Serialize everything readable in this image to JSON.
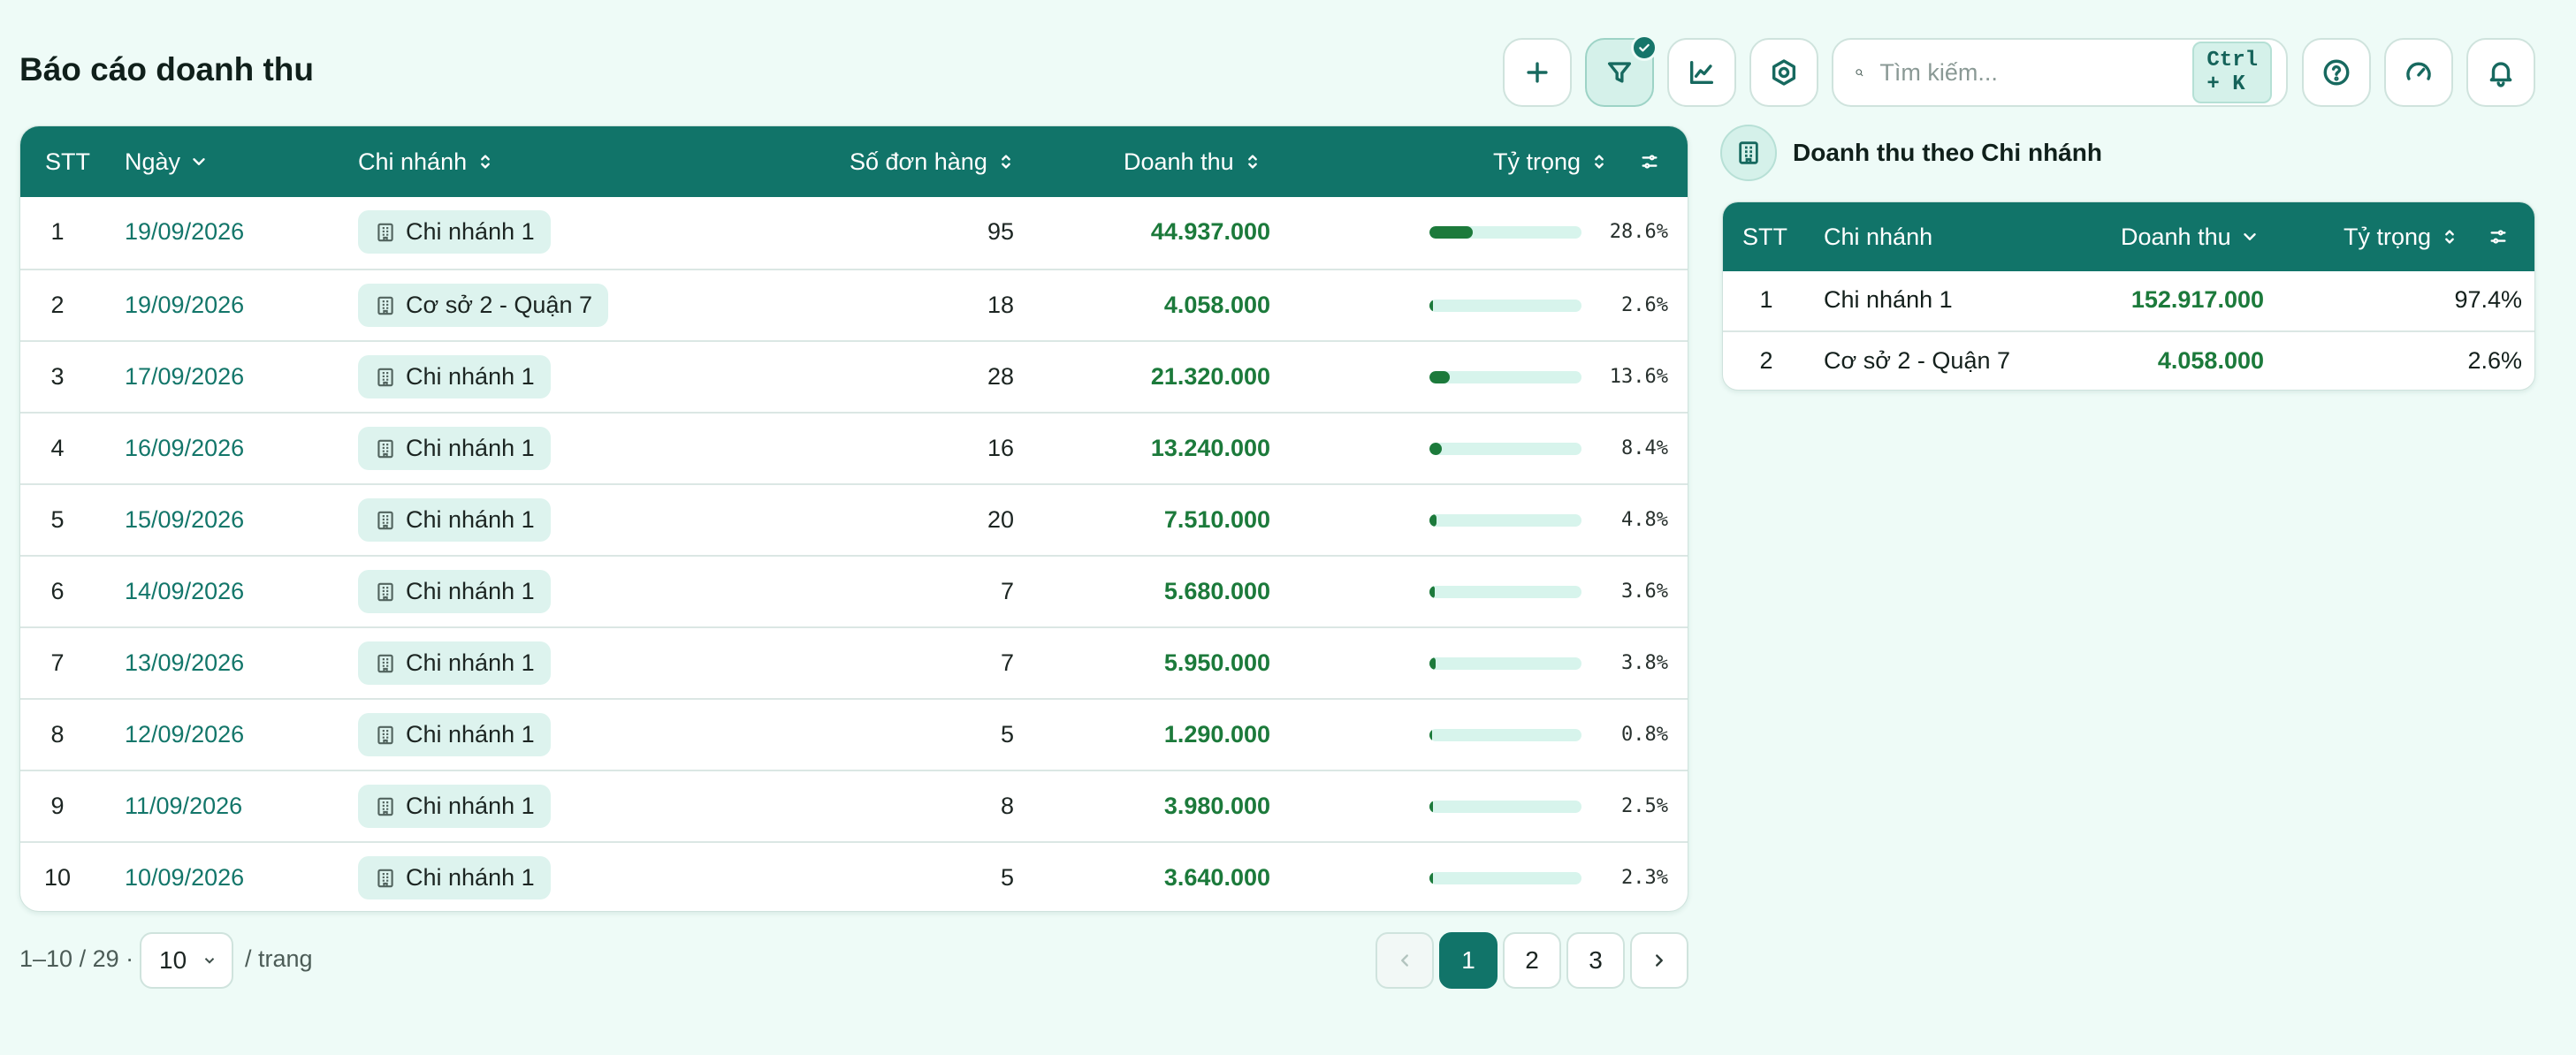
{
  "page": {
    "title": "Báo cáo doanh thu"
  },
  "search": {
    "placeholder": "Tìm kiếm...",
    "shortcut": "Ctrl + K"
  },
  "toolbar": {
    "icons": [
      "plus-icon",
      "filter-icon",
      "line-chart-icon",
      "settings-icon",
      "search-icon",
      "help-icon",
      "gauge-icon",
      "bell-icon"
    ],
    "filter_active": true
  },
  "table": {
    "columns": {
      "stt": "STT",
      "date": "Ngày",
      "branch": "Chi nhánh",
      "orders": "Số đơn hàng",
      "revenue": "Doanh thu",
      "share": "Tỷ trọng"
    },
    "rows": [
      {
        "stt": "1",
        "date": "19/09/2026",
        "branch": "Chi nhánh 1",
        "orders": "95",
        "revenue": "44.937.000",
        "share": "28.6%",
        "share_value": 28.6
      },
      {
        "stt": "2",
        "date": "19/09/2026",
        "branch": "Cơ sở 2 - Quận 7",
        "orders": "18",
        "revenue": "4.058.000",
        "share": "2.6%",
        "share_value": 2.6
      },
      {
        "stt": "3",
        "date": "17/09/2026",
        "branch": "Chi nhánh 1",
        "orders": "28",
        "revenue": "21.320.000",
        "share": "13.6%",
        "share_value": 13.6
      },
      {
        "stt": "4",
        "date": "16/09/2026",
        "branch": "Chi nhánh 1",
        "orders": "16",
        "revenue": "13.240.000",
        "share": "8.4%",
        "share_value": 8.4
      },
      {
        "stt": "5",
        "date": "15/09/2026",
        "branch": "Chi nhánh 1",
        "orders": "20",
        "revenue": "7.510.000",
        "share": "4.8%",
        "share_value": 4.8
      },
      {
        "stt": "6",
        "date": "14/09/2026",
        "branch": "Chi nhánh 1",
        "orders": "7",
        "revenue": "5.680.000",
        "share": "3.6%",
        "share_value": 3.6
      },
      {
        "stt": "7",
        "date": "13/09/2026",
        "branch": "Chi nhánh 1",
        "orders": "7",
        "revenue": "5.950.000",
        "share": "3.8%",
        "share_value": 3.8
      },
      {
        "stt": "8",
        "date": "12/09/2026",
        "branch": "Chi nhánh 1",
        "orders": "5",
        "revenue": "1.290.000",
        "share": "0.8%",
        "share_value": 0.8
      },
      {
        "stt": "9",
        "date": "11/09/2026",
        "branch": "Chi nhánh 1",
        "orders": "8",
        "revenue": "3.980.000",
        "share": "2.5%",
        "share_value": 2.5
      },
      {
        "stt": "10",
        "date": "10/09/2026",
        "branch": "Chi nhánh 1",
        "orders": "5",
        "revenue": "3.640.000",
        "share": "2.3%",
        "share_value": 2.3
      }
    ]
  },
  "pagination": {
    "info": "1–10 / 29 ·",
    "page_size": "10",
    "unit": "/ trang",
    "pages": [
      "1",
      "2",
      "3"
    ],
    "current": "1"
  },
  "side_panel": {
    "title": "Doanh thu theo Chi nhánh",
    "columns": {
      "stt": "STT",
      "branch": "Chi nhánh",
      "revenue": "Doanh thu",
      "share": "Tỷ trọng"
    },
    "rows": [
      {
        "stt": "1",
        "branch": "Chi nhánh 1",
        "revenue": "152.917.000",
        "share": "97.4%"
      },
      {
        "stt": "2",
        "branch": "Cơ sở 2 - Quận 7",
        "revenue": "4.058.000",
        "share": "2.6%"
      }
    ]
  },
  "colors": {
    "accent": "#117469",
    "revenue_text": "#1c7a3b",
    "background": "#eefbf7",
    "chip_background": "#ddf3ee"
  }
}
